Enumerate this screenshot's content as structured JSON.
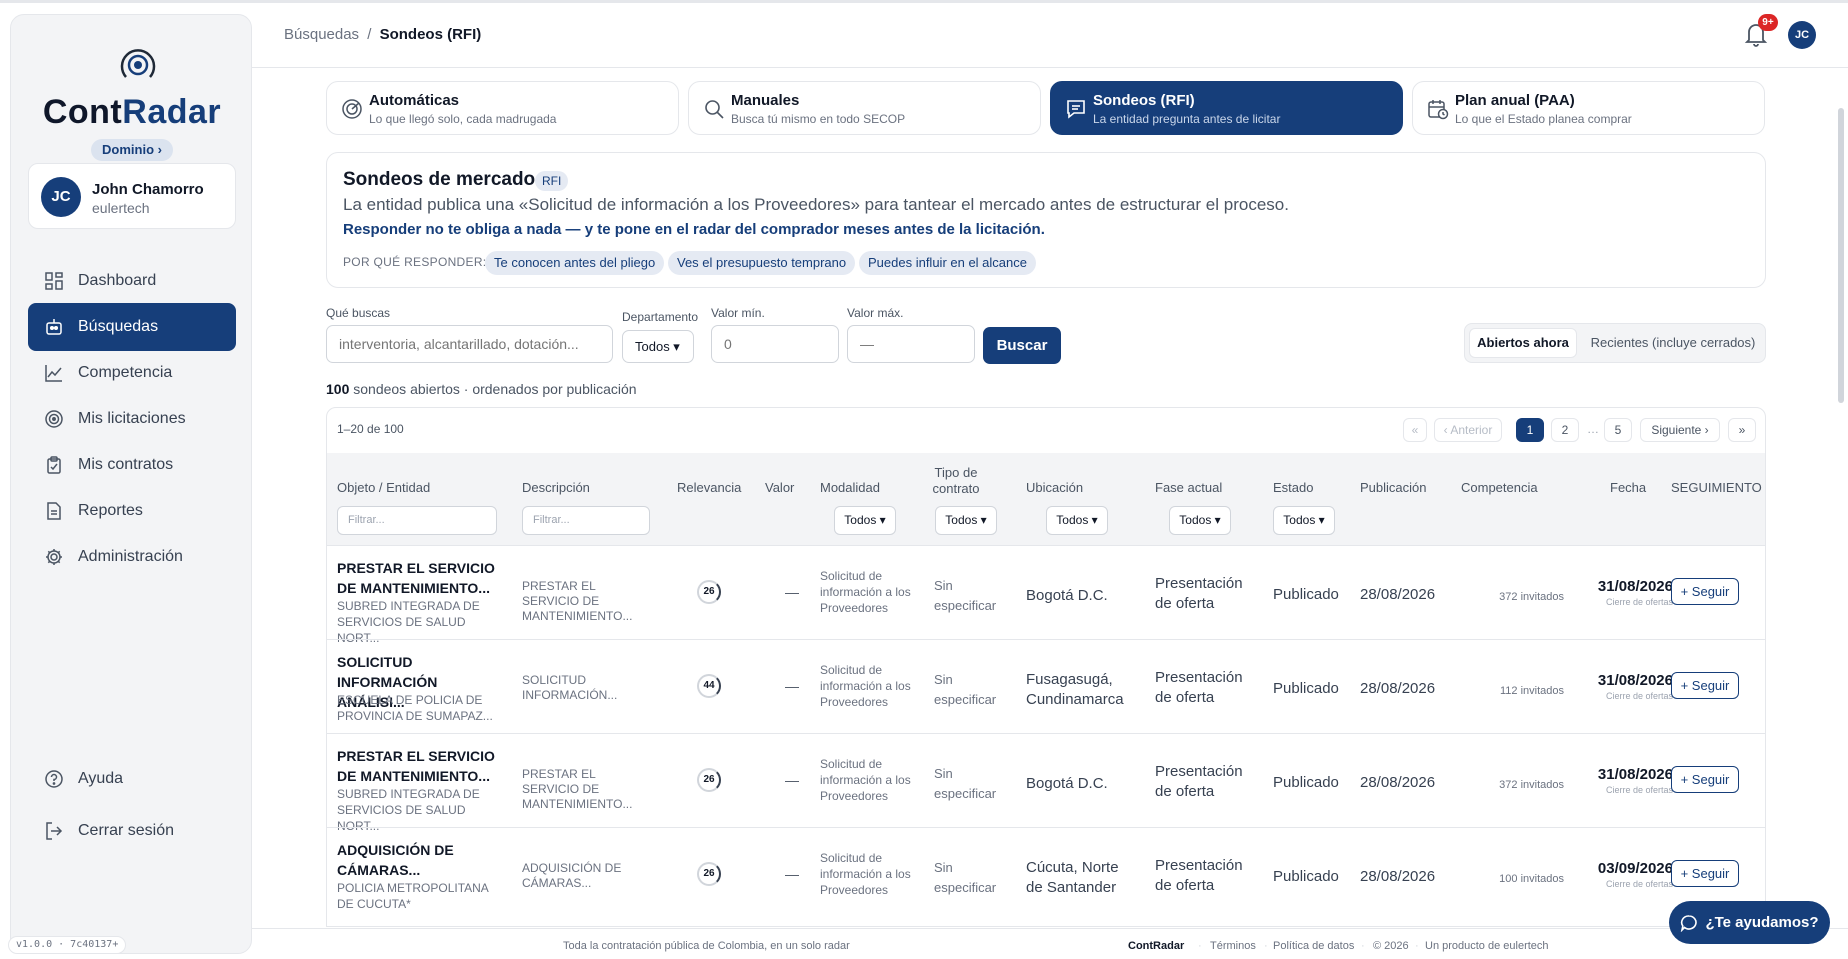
{
  "app": {
    "logo_text_a": "Cont",
    "logo_text_b": "Radar",
    "domain_label": "Dominio ›"
  },
  "user": {
    "initials": "JC",
    "name": "John Chamorro",
    "org": "eulertech"
  },
  "sidebar": {
    "items": [
      {
        "label": "Dashboard",
        "icon": "dashboard-icon"
      },
      {
        "label": "Búsquedas",
        "icon": "search-robot-icon",
        "active": true
      },
      {
        "label": "Competencia",
        "icon": "chart-line-icon"
      },
      {
        "label": "Mis licitaciones",
        "icon": "target-icon"
      },
      {
        "label": "Mis contratos",
        "icon": "clipboard-check-icon"
      },
      {
        "label": "Reportes",
        "icon": "document-icon"
      },
      {
        "label": "Administración",
        "icon": "gear-icon"
      }
    ],
    "bottom": [
      {
        "label": "Ayuda",
        "icon": "help-icon"
      },
      {
        "label": "Cerrar sesión",
        "icon": "logout-icon"
      }
    ],
    "version": "v1.0.0 · 7c40137+"
  },
  "header": {
    "breadcrumb_parent": "Búsquedas",
    "breadcrumb_sep": "/",
    "breadcrumb_current": "Sondeos (RFI)",
    "notif_badge": "9+",
    "avatar": "JC"
  },
  "tabs": [
    {
      "title": "Automáticas",
      "sub": "Lo que llegó solo, cada madrugada",
      "icon": "radar-icon"
    },
    {
      "title": "Manuales",
      "sub": "Busca tú mismo en todo SECOP",
      "icon": "search-icon"
    },
    {
      "title": "Sondeos (RFI)",
      "sub": "La entidad pregunta antes de licitar",
      "icon": "message-icon",
      "active": true
    },
    {
      "title": "Plan anual (PAA)",
      "sub": "Lo que el Estado planea comprar",
      "icon": "calendar-clock-icon"
    }
  ],
  "info": {
    "title": "Sondeos de mercado",
    "tag": "RFI",
    "desc": "La entidad publica una «Solicitud de información a los Proveedores» para tantear el mercado antes de estructurar el proceso.",
    "strong": "Responder no te obliga a nada — y te pone en el radar del comprador meses antes de la licitación.",
    "why_label": "POR QUÉ RESPONDER:",
    "chips": [
      "Te conocen antes del pliego",
      "Ves el presupuesto temprano",
      "Puedes influir en el alcance"
    ]
  },
  "filters": {
    "query_label": "Qué buscas",
    "query_placeholder": "interventoria, alcantarillado, dotación...",
    "dept_label": "Departamento",
    "dept_value": "Todos ▾",
    "min_label": "Valor mín.",
    "min_placeholder": "0",
    "max_label": "Valor máx.",
    "max_placeholder": "—",
    "search_button": "Buscar",
    "toggle_open": "Abiertos ahora",
    "toggle_recent": "Recientes (incluye cerrados)"
  },
  "summary": {
    "count": "100",
    "text": " sondeos abiertos · ordenados por publicación"
  },
  "table": {
    "range": "1–20 de 100",
    "pagination": {
      "first": "«",
      "prev": "‹ Anterior",
      "p1": "1",
      "p2": "2",
      "ellipsis": "…",
      "p5": "5",
      "next": "Siguiente ›",
      "last": "»"
    },
    "headers": {
      "objeto": "Objeto / Entidad",
      "descripcion": "Descripción",
      "relevancia": "Relevancia",
      "valor": "Valor",
      "modalidad": "Modalidad",
      "tipo_a": "Tipo de",
      "tipo_b": "contrato",
      "ubicacion": "Ubicación",
      "fase": "Fase actual",
      "estado": "Estado",
      "publicacion": "Publicación",
      "competencia": "Competencia",
      "fecha": "Fecha",
      "seguimiento": "SEGUIMIENTO"
    },
    "filter_placeholder_obj": "Filtrar...",
    "filter_placeholder_desc": "Filtrar...",
    "select_all": "Todos ▾",
    "rows": [
      {
        "obj": "PRESTAR EL SERVICIO DE MANTENIMIENTO...",
        "ent": "SUBRED INTEGRADA DE SERVICIOS DE SALUD NORT...",
        "desc": "PRESTAR EL SERVICIO DE MANTENIMIENTO...",
        "rel": "26",
        "val": "—",
        "mod": "Solicitud de información a los Proveedores",
        "tipo": "Sin especificar",
        "ubi": "Bogotá D.C.",
        "fase": "Presentación de oferta",
        "estado": "Publicado",
        "pub": "28/08/2026",
        "comp": "372 invitados",
        "fecha": "31/08/2026",
        "cierre": "Cierre de ofertas",
        "btn": "+ Seguir"
      },
      {
        "obj": "SOLICITUD INFORMACIÓN ANÁLISI...",
        "ent": "ESCUELA DE POLICIA DE PROVINCIA DE SUMAPAZ...",
        "desc": "SOLICITUD INFORMACIÓN...",
        "rel": "44",
        "val": "—",
        "mod": "Solicitud de información a los Proveedores",
        "tipo": "Sin especificar",
        "ubi": "Fusagasugá, Cundinamarca",
        "fase": "Presentación de oferta",
        "estado": "Publicado",
        "pub": "28/08/2026",
        "comp": "112 invitados",
        "fecha": "31/08/2026",
        "cierre": "Cierre de ofertas",
        "btn": "+ Seguir"
      },
      {
        "obj": "PRESTAR EL SERVICIO DE MANTENIMIENTO...",
        "ent": "SUBRED INTEGRADA DE SERVICIOS DE SALUD NORT...",
        "desc": "PRESTAR EL SERVICIO DE MANTENIMIENTO...",
        "rel": "26",
        "val": "—",
        "mod": "Solicitud de información a los Proveedores",
        "tipo": "Sin especificar",
        "ubi": "Bogotá D.C.",
        "fase": "Presentación de oferta",
        "estado": "Publicado",
        "pub": "28/08/2026",
        "comp": "372 invitados",
        "fecha": "31/08/2026",
        "cierre": "Cierre de ofertas",
        "btn": "+ Seguir"
      },
      {
        "obj": "ADQUISICIÓN DE CÁMARAS...",
        "ent": "POLICIA METROPOLITANA DE CUCUTA*",
        "desc": "ADQUISICIÓN DE CÁMARAS...",
        "rel": "26",
        "val": "—",
        "mod": "Solicitud de información a los Proveedores",
        "tipo": "Sin especificar",
        "ubi": "Cúcuta, Norte de Santander",
        "fase": "Presentación de oferta",
        "estado": "Publicado",
        "pub": "28/08/2026",
        "comp": "100 invitados",
        "fecha": "03/09/2026",
        "cierre": "Cierre de ofertas",
        "btn": "+ Seguir"
      }
    ]
  },
  "footer": {
    "tagline": "Toda la contratación pública de Colombia, en un solo radar",
    "brand": "ContRadar",
    "terms": "Términos",
    "privacy": "Política de datos",
    "copyright": "© 2026",
    "product": "Un producto de eulertech",
    "sep": "·"
  },
  "help_button": "¿Te ayudamos?",
  "colors": {
    "primary": "#163e7a",
    "badge": "#dc2626"
  }
}
